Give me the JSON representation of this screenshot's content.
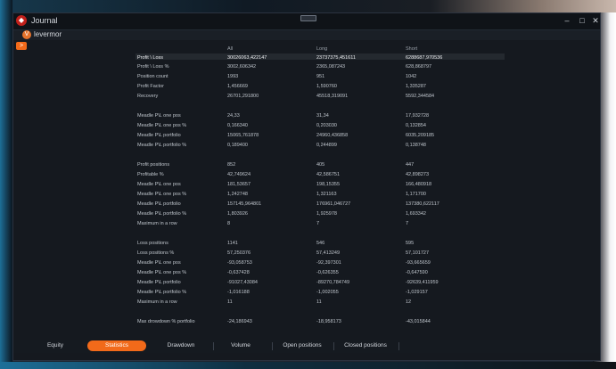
{
  "window": {
    "title": "Journal",
    "user": "levermor",
    "side_button_label": ">"
  },
  "columns": [
    "All",
    "Long",
    "Short"
  ],
  "rows": [
    {
      "label": "Profit \\ Loss",
      "all": "30026063,422147",
      "long": "23737375,451611",
      "short": "6288687,970536",
      "total": true
    },
    {
      "label": "Profit \\ Loss %",
      "all": "3002,606342",
      "long": "2365,087243",
      "short": "628,868797"
    },
    {
      "label": "Position count",
      "all": "1993",
      "long": "951",
      "short": "1042"
    },
    {
      "label": "Profit Factor",
      "all": "1,456669",
      "long": "1,590760",
      "short": "1,335287"
    },
    {
      "label": "Recovery",
      "all": "26701,291800",
      "long": "45518,319091",
      "short": "5592,344584"
    },
    {
      "label": "Meadle P\\L one pos",
      "all": "24,33",
      "long": "31,34",
      "short": "17,932728"
    },
    {
      "label": "Meadle P\\L one pos %",
      "all": "0,166340",
      "long": "0,203030",
      "short": "0,132854"
    },
    {
      "label": "Meadle P\\L portfolio",
      "all": "15065,761878",
      "long": "24960,436858",
      "short": "6035,209185"
    },
    {
      "label": "Meadle P\\L portfolio %",
      "all": "0,189400",
      "long": "0,244899",
      "short": "0,138748"
    },
    {
      "label": "Profit positions",
      "all": "852",
      "long": "405",
      "short": "447"
    },
    {
      "label": "Profitable %",
      "all": "42,749624",
      "long": "42,586751",
      "short": "42,898273"
    },
    {
      "label": "Meadle P\\L one pos",
      "all": "181,53657",
      "long": "198,15355",
      "short": "166,480918"
    },
    {
      "label": "Meadle P\\L one pos %",
      "all": "1,242748",
      "long": "1,321163",
      "short": "1,171700"
    },
    {
      "label": "Meadle P\\L portfolio",
      "all": "157145,964801",
      "long": "176961,046727",
      "short": "137380,622117"
    },
    {
      "label": "Meadle P\\L portfolio %",
      "all": "1,803926",
      "long": "1,925978",
      "short": "1,693342"
    },
    {
      "label": "Maximum in a row",
      "all": "8",
      "long": "7",
      "short": "7"
    },
    {
      "label": "Loss positions",
      "all": "1141",
      "long": "546",
      "short": "595"
    },
    {
      "label": "Loss positions %",
      "all": "57,250376",
      "long": "57,413249",
      "short": "57,101727"
    },
    {
      "label": "Meadle P\\L one pos",
      "all": "-93,058753",
      "long": "-92,397301",
      "short": "-93,665659"
    },
    {
      "label": "Meadle P\\L one pos %",
      "all": "-0,637428",
      "long": "-0,626355",
      "short": "-0,647590"
    },
    {
      "label": "Meadle P\\L portfolio",
      "all": "-91027,43084",
      "long": "-89270,784749",
      "short": "-92639,411959"
    },
    {
      "label": "Meadle P\\L portfolio %",
      "all": "-1,016188",
      "long": "-1,002055",
      "short": "-1,029157"
    },
    {
      "label": "Maximum in a row",
      "all": "11",
      "long": "11",
      "short": "12"
    },
    {
      "label": "Max drowdown % portfolio",
      "all": "-24,186943",
      "long": "-18,958173",
      "short": "-43,015844"
    }
  ],
  "tabs": [
    {
      "label": "Equity"
    },
    {
      "label": "Statistics",
      "active": true
    },
    {
      "label": "Drawdown"
    },
    {
      "label": "Volume"
    },
    {
      "label": "Open positions"
    },
    {
      "label": "Closed positions"
    }
  ],
  "colors": {
    "accent": "#f26a1a",
    "logo": "#c1201b",
    "background": "#15191f"
  }
}
